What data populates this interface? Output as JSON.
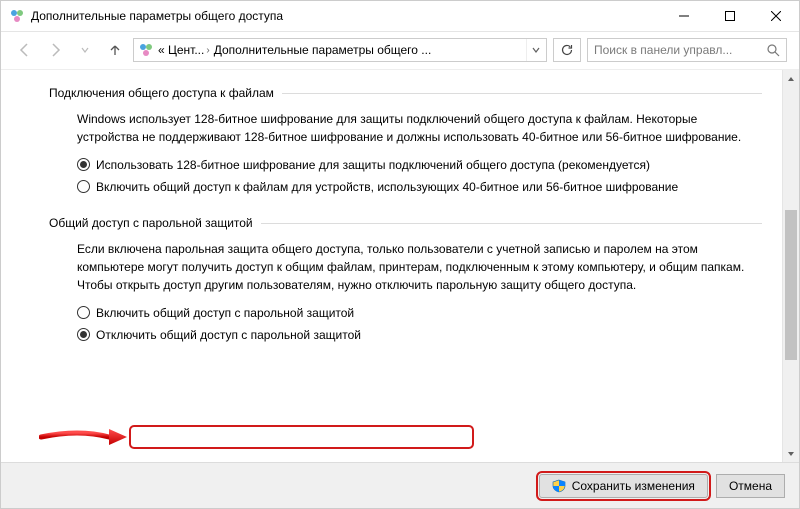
{
  "window": {
    "title": "Дополнительные параметры общего доступа"
  },
  "nav": {
    "crumb1": "« Цент...",
    "crumb2": "Дополнительные параметры общего ...",
    "search_placeholder": "Поиск в панели управл..."
  },
  "section1": {
    "title": "Подключения общего доступа к файлам",
    "desc": "Windows использует 128-битное шифрование для защиты подключений общего доступа к файлам. Некоторые устройства не поддерживают 128-битное шифрование и должны использовать 40-битное или 56-битное шифрование.",
    "opt1": "Использовать 128-битное шифрование для защиты подключений общего доступа (рекомендуется)",
    "opt2": "Включить общий доступ к файлам для устройств, использующих 40-битное или 56-битное шифрование"
  },
  "section2": {
    "title": "Общий доступ с парольной защитой",
    "desc": "Если включена парольная защита общего доступа, только пользователи с учетной записью и паролем на этом компьютере могут получить доступ к общим файлам, принтерам, подключенным к этому компьютеру, и общим папкам. Чтобы открыть доступ другим пользователям, нужно отключить парольную защиту общего доступа.",
    "opt1": "Включить общий доступ с парольной защитой",
    "opt2": "Отключить общий доступ с парольной защитой"
  },
  "footer": {
    "save": "Сохранить изменения",
    "cancel": "Отмена"
  }
}
